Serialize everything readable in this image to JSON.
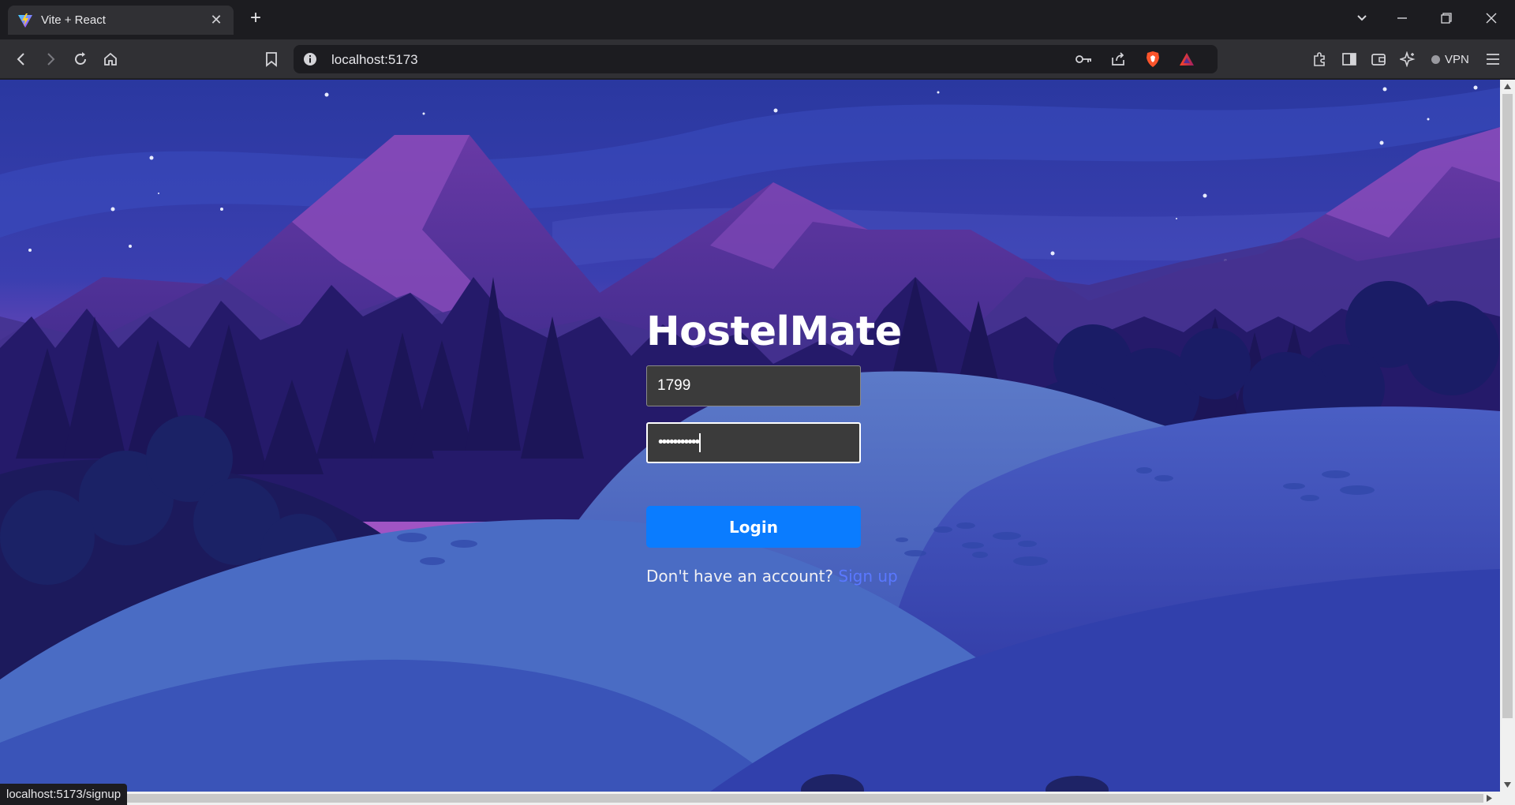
{
  "browser": {
    "tab_title": "Vite + React",
    "url": "localhost:5173",
    "vpn_label": "VPN",
    "status_url": "localhost:5173/signup"
  },
  "login": {
    "brand": "HostelMate",
    "username_value": "1799",
    "password_mask": "•••••••••••",
    "button_label": "Login",
    "signup_prompt": "Don't have an account?",
    "signup_link": "Sign up"
  },
  "colors": {
    "button": "#0a7cff",
    "link": "#5a78ff",
    "input_bg": "#3b3b3b"
  }
}
